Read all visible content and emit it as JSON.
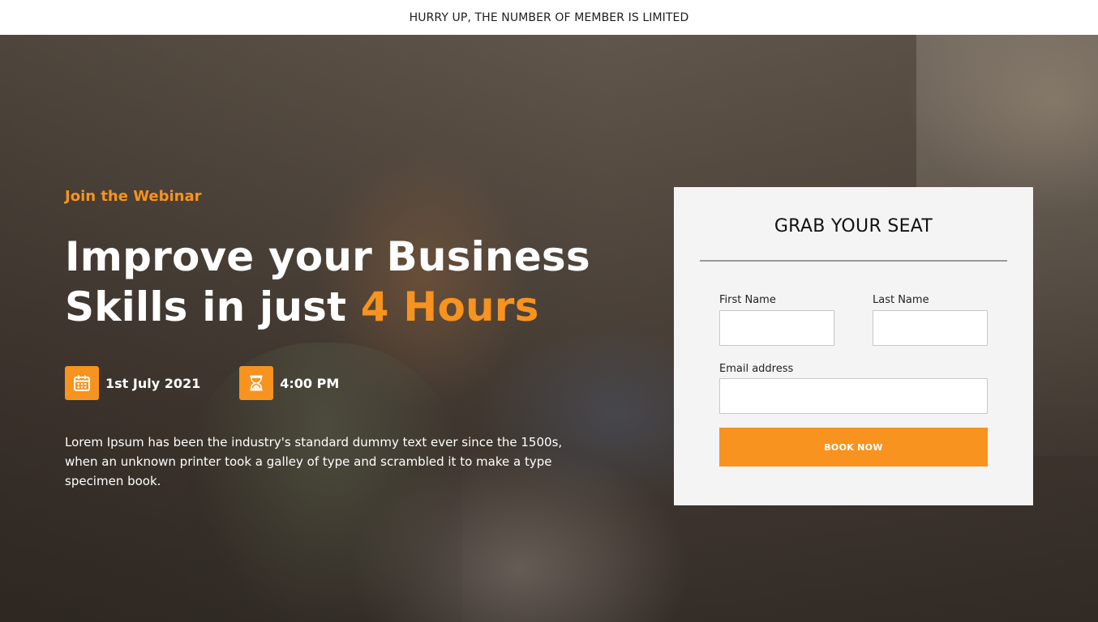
{
  "banner": {
    "text": "HURRY UP, THE NUMBER OF MEMBER IS LIMITED"
  },
  "hero": {
    "eyebrow": "Join the Webinar",
    "headline_line1": "Improve your Business",
    "headline_line2_prefix": "Skills in just ",
    "headline_line2_accent": "4 Hours",
    "date": {
      "icon": "calendar-icon",
      "text": "1st July 2021"
    },
    "time": {
      "icon": "hourglass-icon",
      "text": "4:00 PM"
    },
    "description": "Lorem Ipsum has been the industry's standard dummy text ever since the 1500s, when an unknown printer took a galley of type and scrambled it to make a type specimen book."
  },
  "form": {
    "title": "GRAB YOUR SEAT",
    "first_name": {
      "label": "First Name",
      "value": "",
      "placeholder": ""
    },
    "last_name": {
      "label": "Last Name",
      "value": "",
      "placeholder": ""
    },
    "email": {
      "label": "Email address",
      "value": "",
      "placeholder": ""
    },
    "submit_label": "BOOK NOW"
  },
  "colors": {
    "accent": "#f7931e",
    "banner_bg": "#ffffff",
    "card_bg": "#f4f4f4"
  }
}
